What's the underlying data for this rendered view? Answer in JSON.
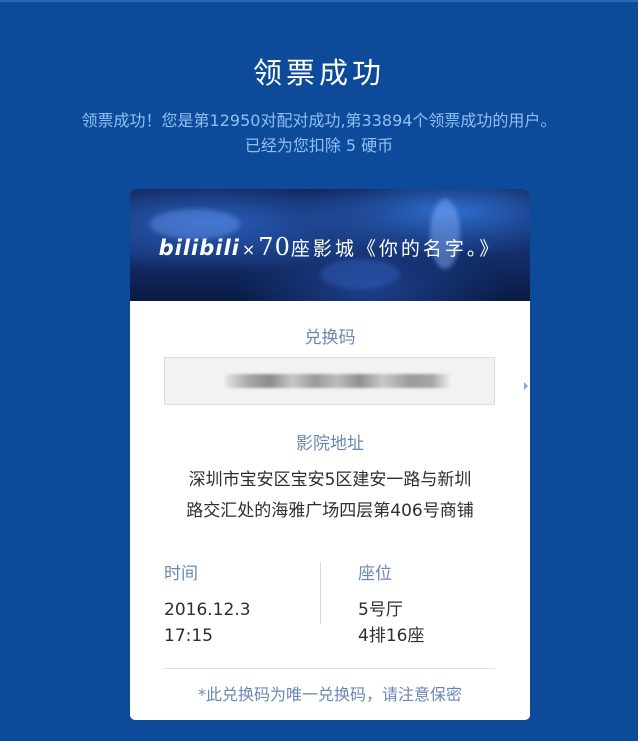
{
  "page": {
    "title": "领票成功",
    "message_line1": "领票成功！您是第12950对配对成功,第33894个领票成功的用户。",
    "message_line2": "已经为您扣除 5 硬币"
  },
  "banner": {
    "logo": "bilibili",
    "cross": "×",
    "number": "70",
    "text": "座影城《你的名字。》"
  },
  "ticket": {
    "code_label": "兑换码",
    "address_label": "影院地址",
    "address_line1": "深圳市宝安区宝安5区建安一路与新圳",
    "address_line2": "路交汇处的海雅广场四层第406号商铺",
    "time_label": "时间",
    "date": "2016.12.3",
    "time": "17:15",
    "seat_label": "座位",
    "hall": "5号厅",
    "seat": "4排16座",
    "notice": "*此兑换码为唯一兑换码，请注意保密"
  },
  "colors": {
    "background": "#0d4a9a",
    "accent_text": "#8fc0f2",
    "label_text": "#6a87b3"
  }
}
